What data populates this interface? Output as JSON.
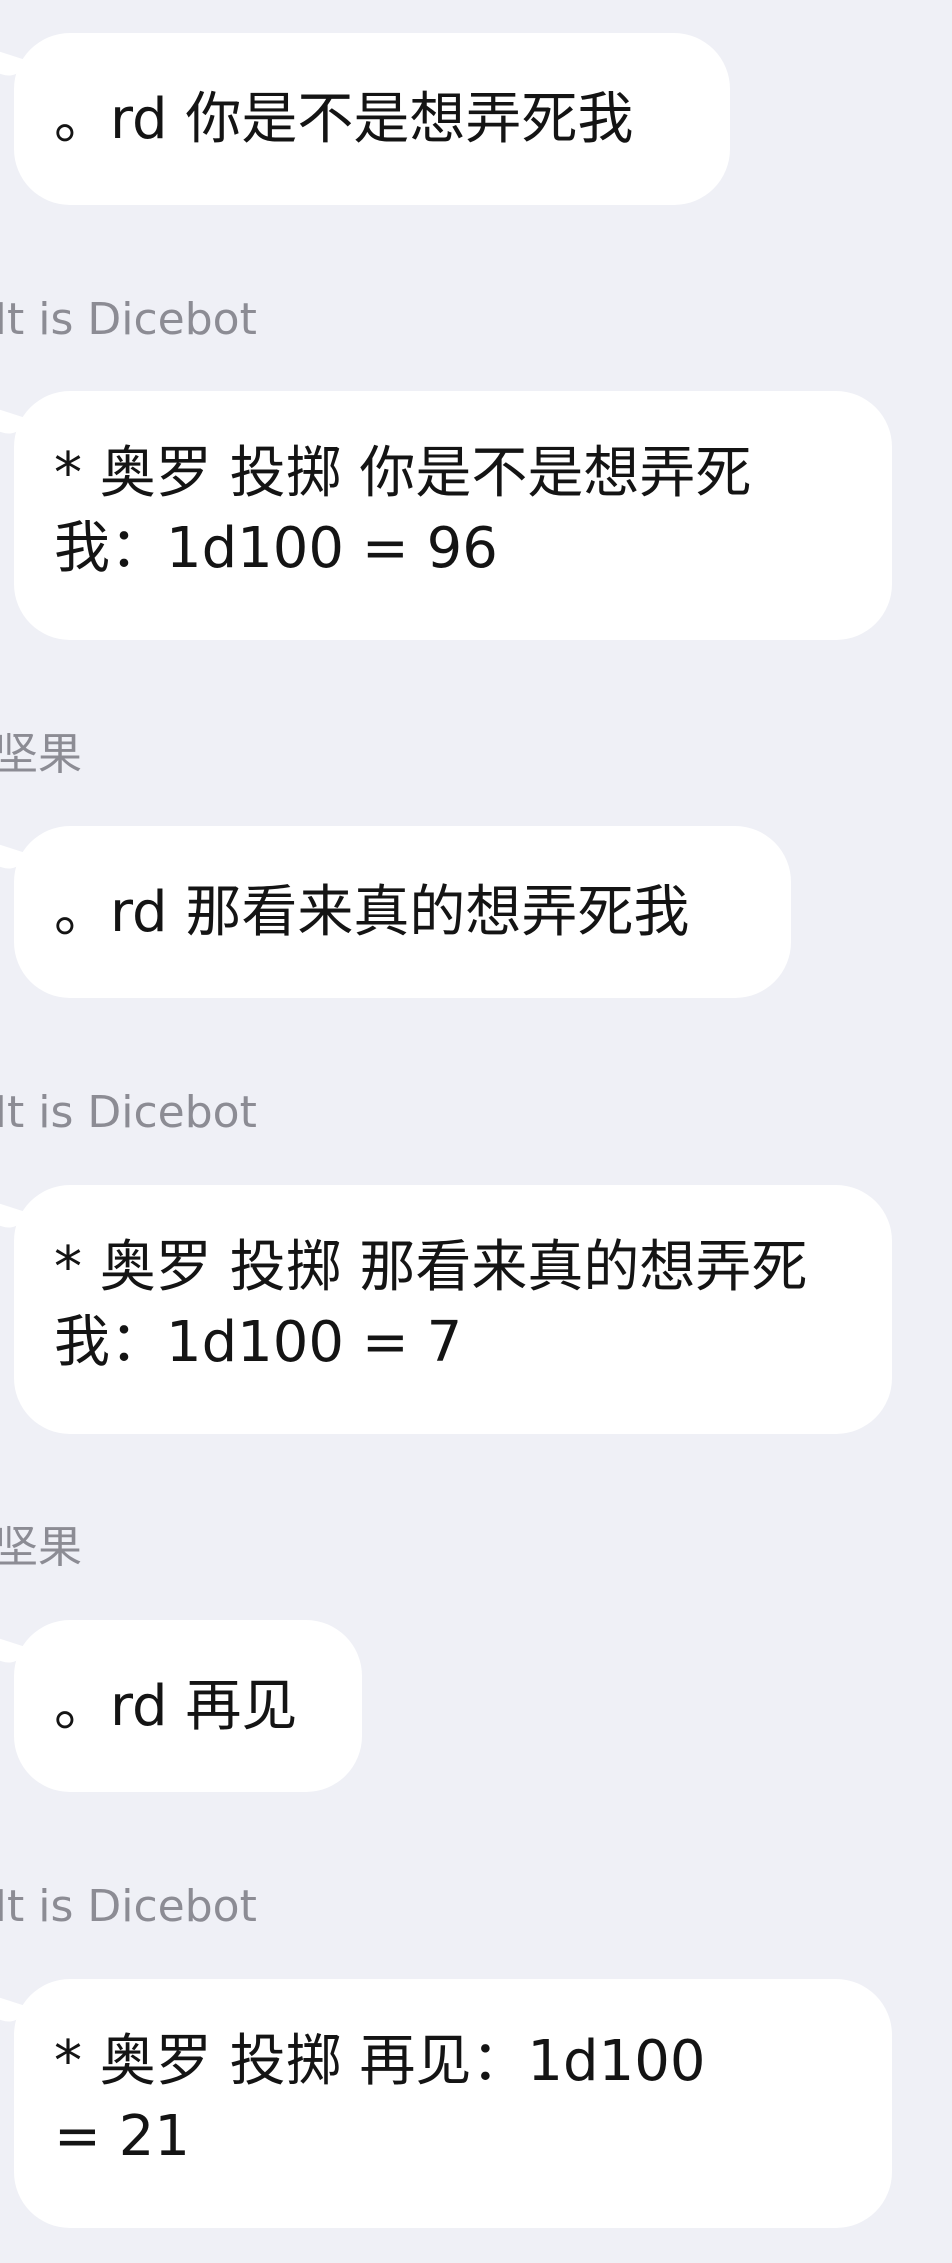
{
  "messages": [
    {
      "sender": "",
      "text": "。rd 你是不是想弄死我"
    },
    {
      "sender": "It is Dicebot",
      "text": "* 奥罗 投掷 你是不是想弄死我：1d100 = 96"
    },
    {
      "sender": "坚果",
      "text": "。rd 那看来真的想弄死我"
    },
    {
      "sender": "It is Dicebot",
      "text": "* 奥罗 投掷 那看来真的想弄死我：1d100 = 7"
    },
    {
      "sender": "坚果",
      "text": "。rd 再见"
    },
    {
      "sender": "It is Dicebot",
      "text": "* 奥罗 投掷 再见：1d100 = 21"
    }
  ]
}
